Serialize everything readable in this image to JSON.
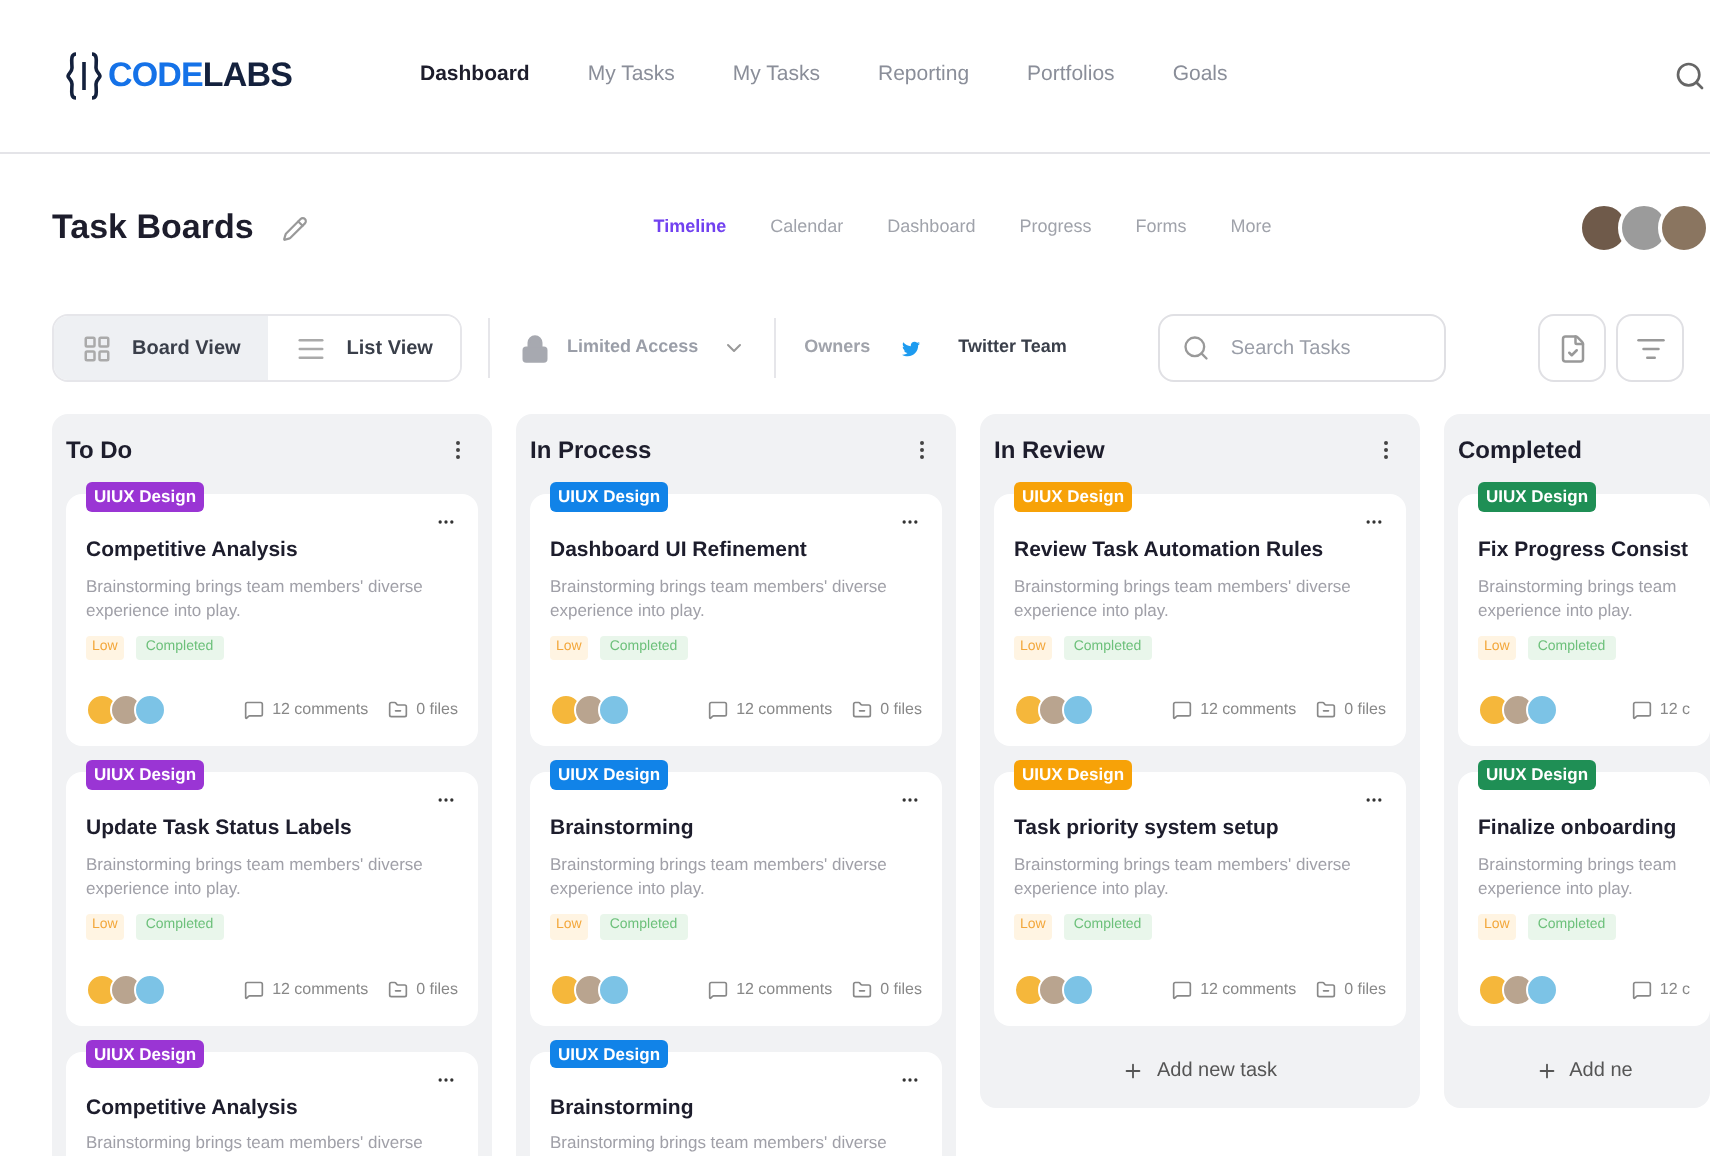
{
  "header": {
    "logo": {
      "primary": "CODE",
      "secondary": "LABS"
    },
    "nav": [
      {
        "label": "Dashboard",
        "selected": true
      },
      {
        "label": "My Tasks",
        "selected": false
      },
      {
        "label": "My Tasks",
        "selected": false
      },
      {
        "label": "Reporting",
        "selected": false
      },
      {
        "label": "Portfolios",
        "selected": false
      },
      {
        "label": "Goals",
        "selected": false
      }
    ]
  },
  "page": {
    "title": "Task Boards",
    "tabs": [
      {
        "label": "Timeline",
        "selected": true
      },
      {
        "label": "Calendar",
        "selected": false
      },
      {
        "label": "Dashboard",
        "selected": false
      },
      {
        "label": "Progress",
        "selected": false
      },
      {
        "label": "Forms",
        "selected": false
      },
      {
        "label": "More",
        "selected": false
      }
    ]
  },
  "toolbar": {
    "views": [
      {
        "label": "Board View",
        "kind": "grid",
        "selected": true
      },
      {
        "label": "List View",
        "kind": "list",
        "selected": false
      }
    ],
    "access": "Limited Access",
    "owners_label": "Owners",
    "team": "Twitter Team",
    "search": {
      "placeholder": "Search Tasks"
    }
  },
  "columns": [
    {
      "title": "To Do",
      "cards": [
        {
          "tag": {
            "label": "UIUX Design",
            "color": "#9a35d4"
          },
          "title": "Competitive Analysis",
          "description": "Brainstorming brings team members' diverse experience into play.",
          "priority": "Low",
          "status": "Completed",
          "comments": "12 comments",
          "files": "0 files"
        },
        {
          "tag": {
            "label": "UIUX Design",
            "color": "#9a35d4"
          },
          "title": "Update Task Status Labels",
          "description": "Brainstorming brings team members' diverse experience into play.",
          "priority": "Low",
          "status": "Completed",
          "comments": "12 comments",
          "files": "0 files"
        },
        {
          "tag": {
            "label": "UIUX Design",
            "color": "#9a35d4"
          },
          "title": "Competitive Analysis",
          "description": "Brainstorming brings team members' diverse"
        }
      ]
    },
    {
      "title": "In Process",
      "cards": [
        {
          "tag": {
            "label": "UIUX Design",
            "color": "#1183e8"
          },
          "title": "Dashboard UI Refinement",
          "description": "Brainstorming brings team members' diverse experience into play.",
          "priority": "Low",
          "status": "Completed",
          "comments": "12 comments",
          "files": "0 files"
        },
        {
          "tag": {
            "label": "UIUX Design",
            "color": "#1183e8"
          },
          "title": "Brainstorming",
          "description": "Brainstorming brings team members' diverse experience into play.",
          "priority": "Low",
          "status": "Completed",
          "comments": "12 comments",
          "files": "0 files"
        },
        {
          "tag": {
            "label": "UIUX Design",
            "color": "#1183e8"
          },
          "title": "Brainstorming",
          "description": "Brainstorming brings team members' diverse"
        }
      ]
    },
    {
      "title": "In Review",
      "add_label": "Add new task",
      "cards": [
        {
          "tag": {
            "label": "UIUX Design",
            "color": "#f7a208"
          },
          "title": "Review Task Automation Rules",
          "description": "Brainstorming brings team members' diverse experience into play.",
          "priority": "Low",
          "status": "Completed",
          "comments": "12 comments",
          "files": "0 files"
        },
        {
          "tag": {
            "label": "UIUX Design",
            "color": "#f7a208"
          },
          "title": "Task priority system setup",
          "description": "Brainstorming brings team members' diverse experience into play.",
          "priority": "Low",
          "status": "Completed",
          "comments": "12 comments",
          "files": "0 files"
        }
      ]
    },
    {
      "title": "Completed",
      "add_label": "Add ne",
      "cards": [
        {
          "tag": {
            "label": "UIUX Design",
            "color": "#1f8f55"
          },
          "title": "Fix Progress Consist",
          "description": "Brainstorming brings team experience into play.",
          "priority": "Low",
          "status": "Completed",
          "comments": "12 c"
        },
        {
          "tag": {
            "label": "UIUX Design",
            "color": "#1f8f55"
          },
          "title": "Finalize onboarding",
          "description": "Brainstorming brings team experience into play.",
          "priority": "Low",
          "status": "Completed",
          "comments": "12 c"
        }
      ]
    }
  ]
}
